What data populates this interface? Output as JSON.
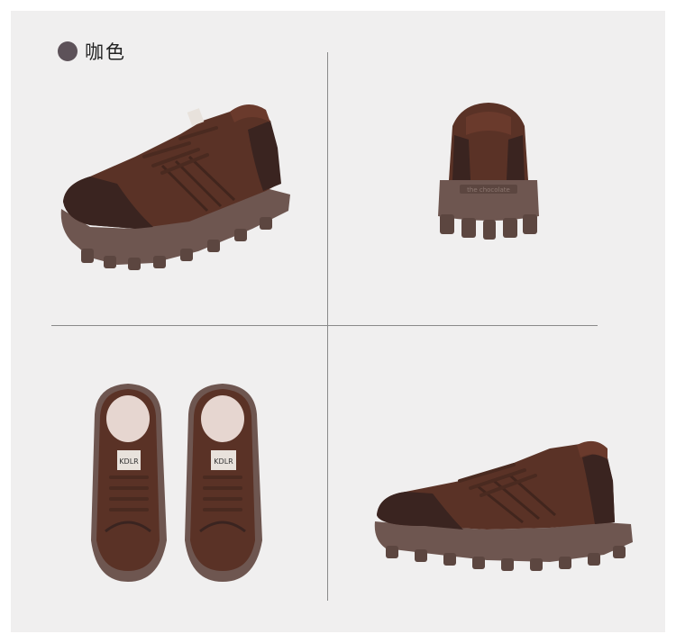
{
  "color_label": {
    "text": "咖色",
    "swatch_color": "#5d5259"
  },
  "views": [
    {
      "name": "side-view",
      "icon": "shoe-side"
    },
    {
      "name": "back-view",
      "icon": "shoe-back",
      "heel_text": "the chocolate"
    },
    {
      "name": "top-view",
      "icon": "shoe-pair-top",
      "tongue_label": "KDLR"
    },
    {
      "name": "side-view-right",
      "icon": "shoe-side-right"
    }
  ],
  "colors": {
    "leather": "#5a3226",
    "suede": "#3a2420",
    "sole": "#6e5650",
    "background": "#f0efef"
  }
}
